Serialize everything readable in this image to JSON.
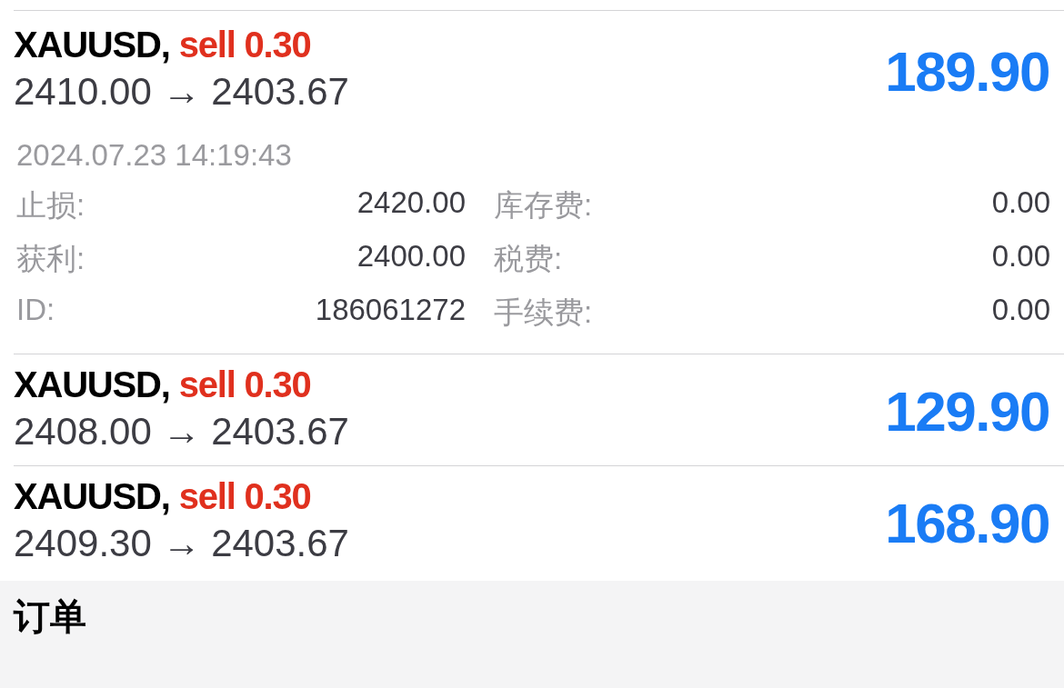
{
  "positions": [
    {
      "symbol": "XAUUSD,",
      "trade": "sell 0.30",
      "prices": "2410.00 → 2403.67",
      "profit": "189.90",
      "expanded": true,
      "time": "2024.07.23 14:19:43",
      "details": [
        {
          "label": "止损:",
          "value": "2420.00"
        },
        {
          "label": "库存费:",
          "value": "0.00"
        },
        {
          "label": "获利:",
          "value": "2400.00"
        },
        {
          "label": "税费:",
          "value": "0.00"
        },
        {
          "label": "ID:",
          "value": "186061272"
        },
        {
          "label": "手续费:",
          "value": "0.00"
        }
      ]
    },
    {
      "symbol": "XAUUSD,",
      "trade": "sell 0.30",
      "prices": "2408.00 → 2403.67",
      "profit": "129.90",
      "expanded": false
    },
    {
      "symbol": "XAUUSD,",
      "trade": "sell 0.30",
      "prices": "2409.30 → 2403.67",
      "profit": "168.90",
      "expanded": false
    }
  ],
  "section": {
    "title": "订单"
  }
}
